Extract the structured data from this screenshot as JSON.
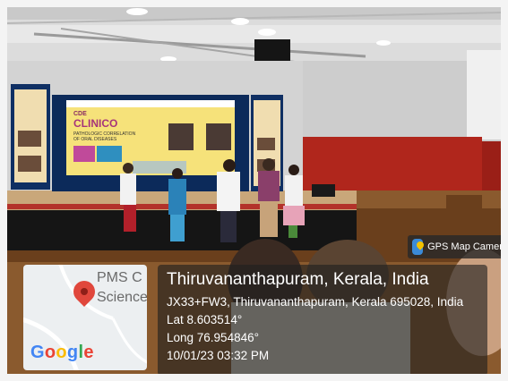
{
  "badge": {
    "label": "GPS Map Camera",
    "icon": "gps-map-camera-icon"
  },
  "map": {
    "place_line_1": "PMS C",
    "place_line_2": "Science",
    "google_letters": [
      {
        "ch": "G",
        "color": "#4285F4"
      },
      {
        "ch": "o",
        "color": "#EA4335"
      },
      {
        "ch": "o",
        "color": "#FBBC05"
      },
      {
        "ch": "g",
        "color": "#4285F4"
      },
      {
        "ch": "l",
        "color": "#34A853"
      },
      {
        "ch": "e",
        "color": "#EA4335"
      }
    ]
  },
  "location": {
    "city": "Thiruvananthapuram, Kerala, India",
    "address": "JX33+FW3, Thiruvananthapuram, Kerala 695028, India",
    "lat": "Lat 8.603514°",
    "long": "Long 76.954846°",
    "datetime": "10/01/23 03:32 PM"
  },
  "screen": {
    "tag": "CDE",
    "title": "CLINICO",
    "subtitle_1": "PATHOLOGIC CORRELATION",
    "subtitle_2": "OF ORAL DISEASES"
  }
}
